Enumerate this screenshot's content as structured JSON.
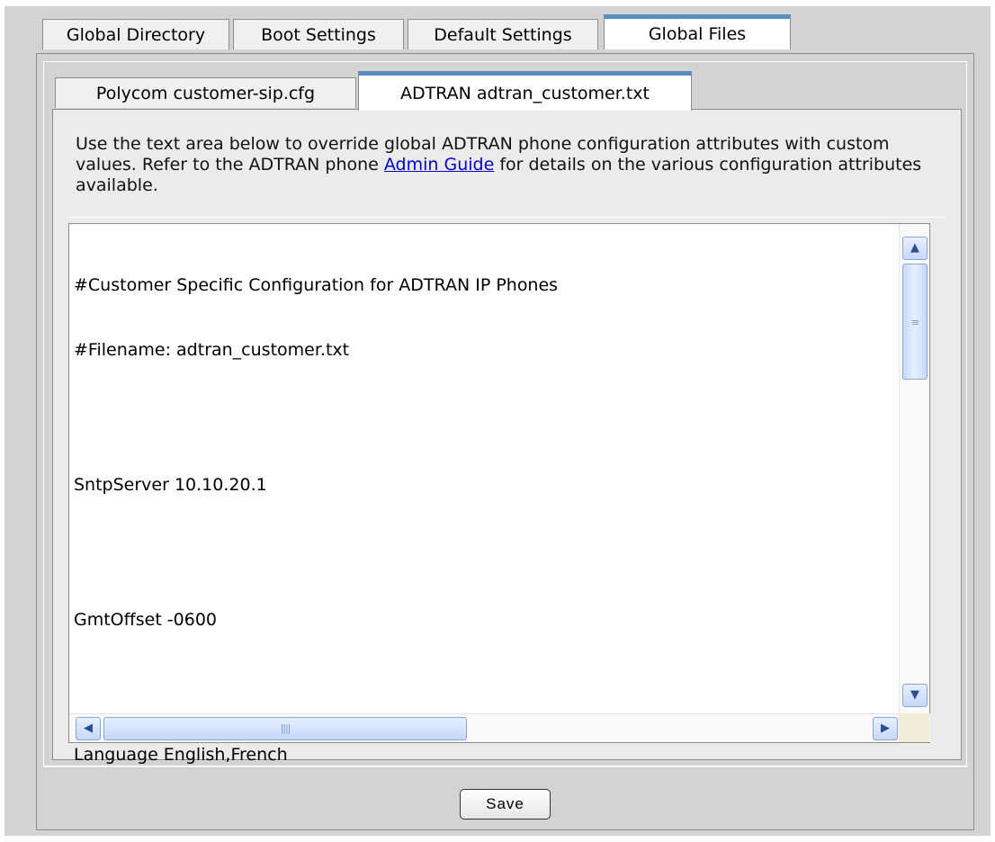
{
  "outer_tabs": [
    {
      "label": "Global Directory",
      "active": false
    },
    {
      "label": "Boot Settings",
      "active": false
    },
    {
      "label": "Default Settings",
      "active": false
    },
    {
      "label": "Global Files",
      "active": true
    }
  ],
  "inner_tabs": [
    {
      "label": "Polycom customer-sip.cfg",
      "active": false
    },
    {
      "label": "ADTRAN adtran_customer.txt",
      "active": true
    }
  ],
  "description": {
    "before_link": "Use the text area below to override global ADTRAN phone configuration attributes with custom values. Refer to the ADTRAN phone ",
    "link_text": "Admin Guide",
    "after_link": " for details on the various configuration attributes available."
  },
  "textarea": {
    "lines": [
      "#Customer Specific Configuration for ADTRAN IP Phones",
      "#Filename: adtran_customer.txt",
      "",
      "SntpServer 10.10.20.1",
      "",
      "GmtOffset -0600",
      "",
      "Language English,French"
    ]
  },
  "save_label": "Save",
  "icons": {
    "scroll_up": "chevron-up-icon",
    "scroll_down": "chevron-down-icon",
    "scroll_left": "chevron-left-icon",
    "scroll_right": "chevron-right-icon"
  },
  "colors": {
    "active_tab_accent": "#5b8dbe",
    "link": "#0000cc",
    "panel_bg": "#d3d3d3"
  }
}
